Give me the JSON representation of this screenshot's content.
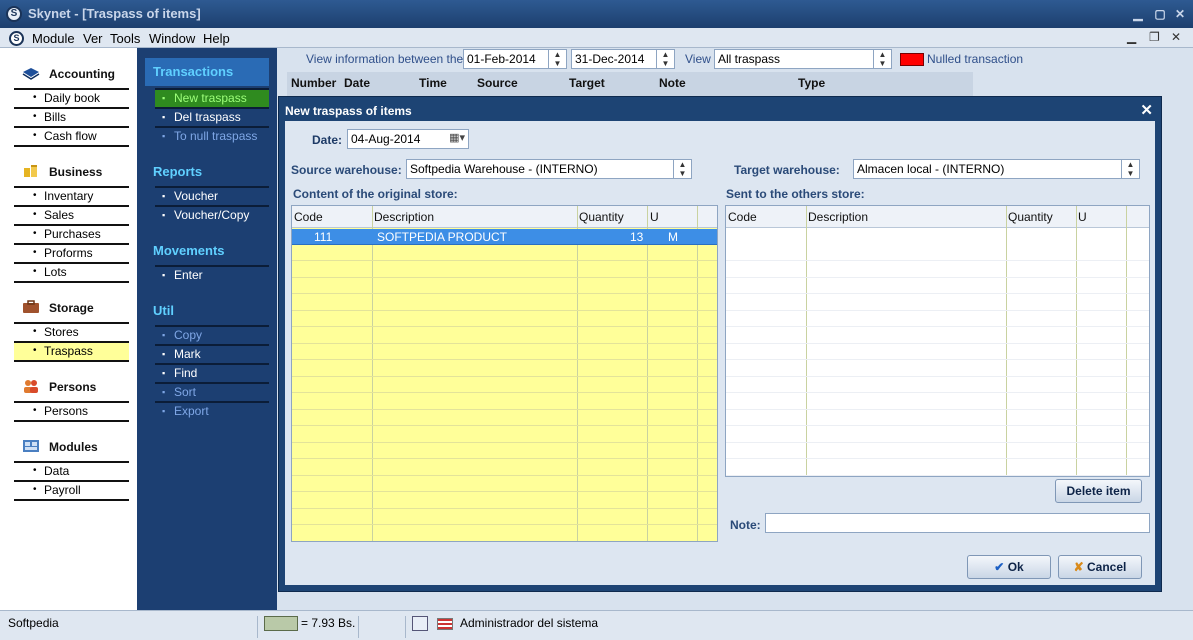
{
  "window": {
    "title": "Skynet - [Traspass of items]",
    "app_icon": "S"
  },
  "menu": [
    "Module",
    "Ver",
    "Tools",
    "Window",
    "Help"
  ],
  "nav": {
    "accounting": {
      "title": "Accounting",
      "items": [
        "Daily book",
        "Bills",
        "Cash flow"
      ]
    },
    "business": {
      "title": "Business",
      "items": [
        "Inventary",
        "Sales",
        "Purchases",
        "Proforms",
        "Lots"
      ]
    },
    "storage": {
      "title": "Storage",
      "items": [
        "Stores",
        "Traspass"
      ]
    },
    "persons": {
      "title": "Persons",
      "items": [
        "Persons"
      ]
    },
    "modules": {
      "title": "Modules",
      "items": [
        "Data",
        "Payroll"
      ]
    }
  },
  "actions": {
    "transactions": {
      "title": "Transactions",
      "items": [
        "New traspass",
        "Del traspass",
        "To null traspass"
      ]
    },
    "reports": {
      "title": "Reports",
      "items": [
        "Voucher",
        "Voucher/Copy"
      ]
    },
    "movements": {
      "title": "Movements",
      "items": [
        "Enter"
      ]
    },
    "util": {
      "title": "Util",
      "items": [
        "Copy",
        "Mark",
        "Find",
        "Sort",
        "Export"
      ]
    }
  },
  "filter": {
    "label": "View information between these",
    "from": "01-Feb-2014",
    "to": "31-Dec-2014",
    "view_label": "View",
    "view_value": "All traspass",
    "nulled_label": "Nulled transaction",
    "nulled_color": "#ff0000"
  },
  "list_columns": [
    "Number",
    "Date",
    "Time",
    "Source",
    "Target",
    "Note",
    "Type"
  ],
  "dialog": {
    "title": "New traspass of items",
    "date_label": "Date:",
    "date_value": "04-Aug-2014",
    "source_label": "Source warehouse:",
    "source_value": "Softpedia Warehouse - (INTERNO)",
    "target_label": "Target warehouse:",
    "target_value": "Almacen local - (INTERNO)",
    "original_store_label": "Content of the original store:",
    "others_store_label": "Sent to the others store:",
    "columns": [
      "Code",
      "Description",
      "Quantity",
      "U"
    ],
    "rows": [
      {
        "code": "111",
        "description": "SOFTPEDIA PRODUCT",
        "quantity": "13",
        "unit": "M"
      }
    ],
    "delete_label": "Delete item",
    "note_label": "Note:",
    "note_value": "",
    "ok_label": "Ok",
    "cancel_label": "Cancel"
  },
  "status": {
    "left": "Softpedia",
    "rate": "= 7.93 Bs.",
    "user": "Administrador del sistema"
  }
}
